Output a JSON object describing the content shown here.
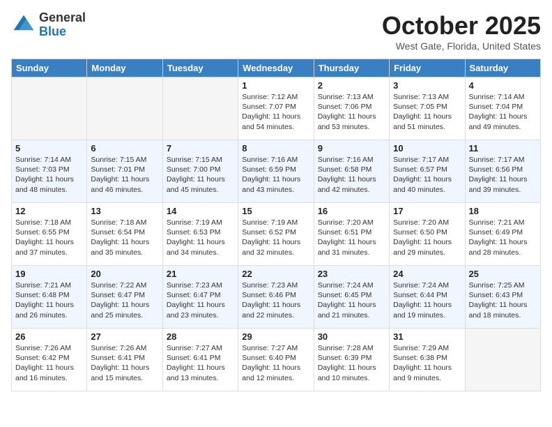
{
  "header": {
    "logo_general": "General",
    "logo_blue": "Blue",
    "month_title": "October 2025",
    "location": "West Gate, Florida, United States"
  },
  "weekdays": [
    "Sunday",
    "Monday",
    "Tuesday",
    "Wednesday",
    "Thursday",
    "Friday",
    "Saturday"
  ],
  "weeks": [
    [
      {
        "day": "",
        "text": ""
      },
      {
        "day": "",
        "text": ""
      },
      {
        "day": "",
        "text": ""
      },
      {
        "day": "1",
        "text": "Sunrise: 7:12 AM\nSunset: 7:07 PM\nDaylight: 11 hours and 54 minutes."
      },
      {
        "day": "2",
        "text": "Sunrise: 7:13 AM\nSunset: 7:06 PM\nDaylight: 11 hours and 53 minutes."
      },
      {
        "day": "3",
        "text": "Sunrise: 7:13 AM\nSunset: 7:05 PM\nDaylight: 11 hours and 51 minutes."
      },
      {
        "day": "4",
        "text": "Sunrise: 7:14 AM\nSunset: 7:04 PM\nDaylight: 11 hours and 49 minutes."
      }
    ],
    [
      {
        "day": "5",
        "text": "Sunrise: 7:14 AM\nSunset: 7:03 PM\nDaylight: 11 hours and 48 minutes."
      },
      {
        "day": "6",
        "text": "Sunrise: 7:15 AM\nSunset: 7:01 PM\nDaylight: 11 hours and 46 minutes."
      },
      {
        "day": "7",
        "text": "Sunrise: 7:15 AM\nSunset: 7:00 PM\nDaylight: 11 hours and 45 minutes."
      },
      {
        "day": "8",
        "text": "Sunrise: 7:16 AM\nSunset: 6:59 PM\nDaylight: 11 hours and 43 minutes."
      },
      {
        "day": "9",
        "text": "Sunrise: 7:16 AM\nSunset: 6:58 PM\nDaylight: 11 hours and 42 minutes."
      },
      {
        "day": "10",
        "text": "Sunrise: 7:17 AM\nSunset: 6:57 PM\nDaylight: 11 hours and 40 minutes."
      },
      {
        "day": "11",
        "text": "Sunrise: 7:17 AM\nSunset: 6:56 PM\nDaylight: 11 hours and 39 minutes."
      }
    ],
    [
      {
        "day": "12",
        "text": "Sunrise: 7:18 AM\nSunset: 6:55 PM\nDaylight: 11 hours and 37 minutes."
      },
      {
        "day": "13",
        "text": "Sunrise: 7:18 AM\nSunset: 6:54 PM\nDaylight: 11 hours and 35 minutes."
      },
      {
        "day": "14",
        "text": "Sunrise: 7:19 AM\nSunset: 6:53 PM\nDaylight: 11 hours and 34 minutes."
      },
      {
        "day": "15",
        "text": "Sunrise: 7:19 AM\nSunset: 6:52 PM\nDaylight: 11 hours and 32 minutes."
      },
      {
        "day": "16",
        "text": "Sunrise: 7:20 AM\nSunset: 6:51 PM\nDaylight: 11 hours and 31 minutes."
      },
      {
        "day": "17",
        "text": "Sunrise: 7:20 AM\nSunset: 6:50 PM\nDaylight: 11 hours and 29 minutes."
      },
      {
        "day": "18",
        "text": "Sunrise: 7:21 AM\nSunset: 6:49 PM\nDaylight: 11 hours and 28 minutes."
      }
    ],
    [
      {
        "day": "19",
        "text": "Sunrise: 7:21 AM\nSunset: 6:48 PM\nDaylight: 11 hours and 26 minutes."
      },
      {
        "day": "20",
        "text": "Sunrise: 7:22 AM\nSunset: 6:47 PM\nDaylight: 11 hours and 25 minutes."
      },
      {
        "day": "21",
        "text": "Sunrise: 7:23 AM\nSunset: 6:47 PM\nDaylight: 11 hours and 23 minutes."
      },
      {
        "day": "22",
        "text": "Sunrise: 7:23 AM\nSunset: 6:46 PM\nDaylight: 11 hours and 22 minutes."
      },
      {
        "day": "23",
        "text": "Sunrise: 7:24 AM\nSunset: 6:45 PM\nDaylight: 11 hours and 21 minutes."
      },
      {
        "day": "24",
        "text": "Sunrise: 7:24 AM\nSunset: 6:44 PM\nDaylight: 11 hours and 19 minutes."
      },
      {
        "day": "25",
        "text": "Sunrise: 7:25 AM\nSunset: 6:43 PM\nDaylight: 11 hours and 18 minutes."
      }
    ],
    [
      {
        "day": "26",
        "text": "Sunrise: 7:26 AM\nSunset: 6:42 PM\nDaylight: 11 hours and 16 minutes."
      },
      {
        "day": "27",
        "text": "Sunrise: 7:26 AM\nSunset: 6:41 PM\nDaylight: 11 hours and 15 minutes."
      },
      {
        "day": "28",
        "text": "Sunrise: 7:27 AM\nSunset: 6:41 PM\nDaylight: 11 hours and 13 minutes."
      },
      {
        "day": "29",
        "text": "Sunrise: 7:27 AM\nSunset: 6:40 PM\nDaylight: 11 hours and 12 minutes."
      },
      {
        "day": "30",
        "text": "Sunrise: 7:28 AM\nSunset: 6:39 PM\nDaylight: 11 hours and 10 minutes."
      },
      {
        "day": "31",
        "text": "Sunrise: 7:29 AM\nSunset: 6:38 PM\nDaylight: 11 hours and 9 minutes."
      },
      {
        "day": "",
        "text": ""
      }
    ]
  ]
}
